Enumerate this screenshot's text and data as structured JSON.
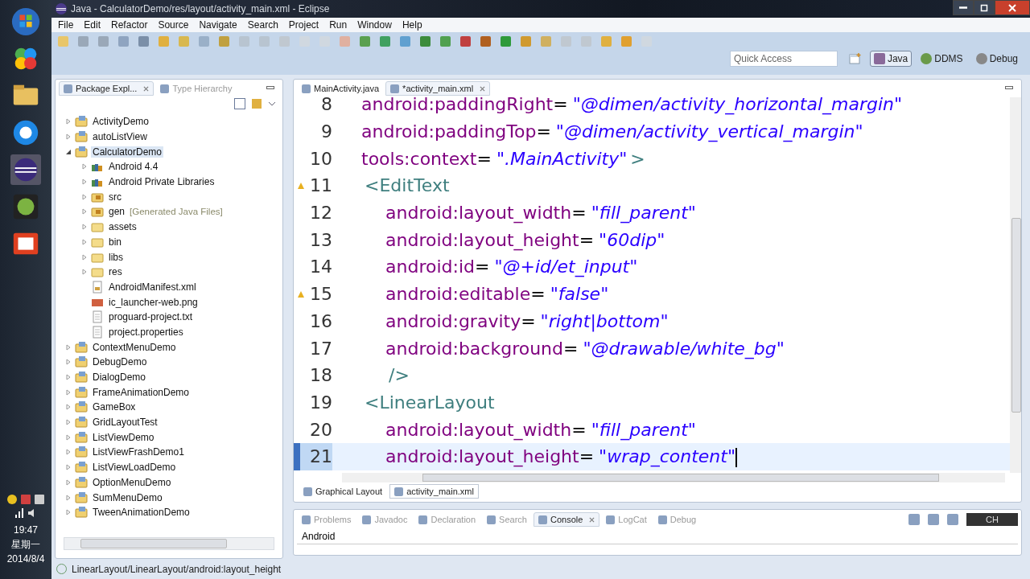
{
  "window": {
    "title": "Java - CalculatorDemo/res/layout/activity_main.xml - Eclipse"
  },
  "menu": [
    "File",
    "Edit",
    "Refactor",
    "Source",
    "Navigate",
    "Search",
    "Project",
    "Run",
    "Window",
    "Help"
  ],
  "quick_access": {
    "placeholder": "Quick Access"
  },
  "perspectives": [
    {
      "label": "Java",
      "selected": true
    },
    {
      "label": "DDMS",
      "selected": false
    },
    {
      "label": "Debug",
      "selected": false
    }
  ],
  "explorer": {
    "tabs": [
      {
        "label": "Package Expl...",
        "selected": true
      },
      {
        "label": "Type Hierarchy",
        "selected": false
      }
    ],
    "tree": [
      {
        "label": "ActivityDemo",
        "kind": "project",
        "expanded": false
      },
      {
        "label": "autoListView",
        "kind": "project",
        "expanded": false
      },
      {
        "label": "CalculatorDemo",
        "kind": "project",
        "expanded": true,
        "selected": true,
        "children": [
          {
            "label": "Android 4.4",
            "kind": "library",
            "expanded": false
          },
          {
            "label": "Android Private Libraries",
            "kind": "library",
            "expanded": false
          },
          {
            "label": "src",
            "kind": "source",
            "expanded": false
          },
          {
            "label": "gen",
            "note": "[Generated Java Files]",
            "kind": "source",
            "expanded": false
          },
          {
            "label": "assets",
            "kind": "folder",
            "expanded": false
          },
          {
            "label": "bin",
            "kind": "folder",
            "expanded": false
          },
          {
            "label": "libs",
            "kind": "folder",
            "expanded": false
          },
          {
            "label": "res",
            "kind": "folder",
            "expanded": false
          },
          {
            "label": "AndroidManifest.xml",
            "kind": "xml"
          },
          {
            "label": "ic_launcher-web.png",
            "kind": "image"
          },
          {
            "label": "proguard-project.txt",
            "kind": "text"
          },
          {
            "label": "project.properties",
            "kind": "text"
          }
        ]
      },
      {
        "label": "ContextMenuDemo",
        "kind": "project",
        "expanded": false
      },
      {
        "label": "DebugDemo",
        "kind": "project",
        "expanded": false
      },
      {
        "label": "DialogDemo",
        "kind": "project",
        "expanded": false
      },
      {
        "label": "FrameAnimationDemo",
        "kind": "project",
        "expanded": false
      },
      {
        "label": "GameBox",
        "kind": "project",
        "expanded": false
      },
      {
        "label": "GridLayoutTest",
        "kind": "project",
        "expanded": false
      },
      {
        "label": "ListViewDemo",
        "kind": "project",
        "expanded": false
      },
      {
        "label": "ListViewFrashDemo1",
        "kind": "project",
        "expanded": false
      },
      {
        "label": "ListViewLoadDemo",
        "kind": "project",
        "expanded": false
      },
      {
        "label": "OptionMenuDemo",
        "kind": "project",
        "expanded": false
      },
      {
        "label": "SumMenuDemo",
        "kind": "project",
        "expanded": false
      },
      {
        "label": "TweenAnimationDemo",
        "kind": "project",
        "expanded": false
      }
    ]
  },
  "editor": {
    "tabs": [
      {
        "label": "MainActivity.java",
        "selected": false
      },
      {
        "label": "*activity_main.xml",
        "selected": true
      }
    ],
    "lines": [
      {
        "number": "8",
        "indented": false,
        "warning": false,
        "current": false,
        "tokens": [
          {
            "kind": "attr",
            "text": "android:paddingRight"
          },
          {
            "kind": "eq",
            "text": "="
          },
          {
            "kind": "value",
            "text": "\"@dimen/activity_horizontal_margin\""
          }
        ]
      },
      {
        "number": "9",
        "indented": false,
        "warning": false,
        "current": false,
        "tokens": [
          {
            "kind": "attr",
            "text": "android:paddingTop"
          },
          {
            "kind": "eq",
            "text": "="
          },
          {
            "kind": "value",
            "text": "\"@dimen/activity_vertical_margin\""
          }
        ]
      },
      {
        "number": "10",
        "indented": false,
        "warning": false,
        "current": false,
        "tokens": [
          {
            "kind": "attr",
            "text": "tools:context"
          },
          {
            "kind": "eq",
            "text": "="
          },
          {
            "kind": "value",
            "text": "\".MainActivity\""
          },
          {
            "kind": "tag",
            "text": ">"
          }
        ]
      },
      {
        "number": "11",
        "indented": false,
        "warning": true,
        "current": false,
        "tokens": [
          {
            "kind": "tag",
            "text": "<EditText"
          }
        ]
      },
      {
        "number": "12",
        "indented": true,
        "warning": false,
        "current": false,
        "tokens": [
          {
            "kind": "attr",
            "text": "android:layout_width"
          },
          {
            "kind": "eq",
            "text": "="
          },
          {
            "kind": "value",
            "text": "\"fill_parent\""
          }
        ]
      },
      {
        "number": "13",
        "indented": true,
        "warning": false,
        "current": false,
        "tokens": [
          {
            "kind": "attr",
            "text": "android:layout_height"
          },
          {
            "kind": "eq",
            "text": "="
          },
          {
            "kind": "value",
            "text": "\"60dip\""
          }
        ]
      },
      {
        "number": "14",
        "indented": true,
        "warning": false,
        "current": false,
        "tokens": [
          {
            "kind": "attr",
            "text": "android:id"
          },
          {
            "kind": "eq",
            "text": "="
          },
          {
            "kind": "value",
            "text": "\"@+id/et_input\""
          }
        ]
      },
      {
        "number": "15",
        "indented": true,
        "warning": true,
        "current": false,
        "tokens": [
          {
            "kind": "attr",
            "text": "android:editable"
          },
          {
            "kind": "eq",
            "text": "="
          },
          {
            "kind": "value",
            "text": "\"false\""
          }
        ]
      },
      {
        "number": "16",
        "indented": true,
        "warning": false,
        "current": false,
        "tokens": [
          {
            "kind": "attr",
            "text": "android:gravity"
          },
          {
            "kind": "eq",
            "text": "="
          },
          {
            "kind": "value",
            "text": "\"right|bottom\""
          }
        ]
      },
      {
        "number": "17",
        "indented": true,
        "warning": false,
        "current": false,
        "tokens": [
          {
            "kind": "attr",
            "text": "android:background"
          },
          {
            "kind": "eq",
            "text": "="
          },
          {
            "kind": "value",
            "text": "\"@drawable/white_bg\""
          }
        ]
      },
      {
        "number": "18",
        "indented": true,
        "warning": false,
        "current": false,
        "tokens": [
          {
            "kind": "tag",
            "text": "/>"
          }
        ]
      },
      {
        "number": "19",
        "indented": false,
        "warning": false,
        "current": false,
        "tokens": [
          {
            "kind": "tag",
            "text": "<LinearLayout"
          }
        ]
      },
      {
        "number": "20",
        "indented": true,
        "warning": false,
        "current": false,
        "tokens": [
          {
            "kind": "attr",
            "text": "android:layout_width"
          },
          {
            "kind": "eq",
            "text": "="
          },
          {
            "kind": "value",
            "text": "\"fill_parent\""
          }
        ]
      },
      {
        "number": "21",
        "indented": true,
        "warning": false,
        "current": true,
        "tokens": [
          {
            "kind": "attr",
            "text": "android:layout_height"
          },
          {
            "kind": "eq",
            "text": "="
          },
          {
            "kind": "value",
            "text": "\"wrap_content\""
          }
        ]
      }
    ],
    "bottom_tabs": [
      {
        "label": "Graphical Layout",
        "selected": false
      },
      {
        "label": "activity_main.xml",
        "selected": true
      }
    ]
  },
  "console": {
    "tabs": [
      {
        "label": "Problems",
        "selected": false
      },
      {
        "label": "Javadoc",
        "selected": false
      },
      {
        "label": "Declaration",
        "selected": false
      },
      {
        "label": "Search",
        "selected": false
      },
      {
        "label": "Console",
        "selected": true
      },
      {
        "label": "LogCat",
        "selected": false
      },
      {
        "label": "Debug",
        "selected": false
      }
    ],
    "text": "Android"
  },
  "language_bar": "CH",
  "status_bar": "LinearLayout/LinearLayout/android:layout_height",
  "taskbar": {
    "time": "19:47",
    "weekday": "星期一",
    "date": "2014/8/4"
  }
}
